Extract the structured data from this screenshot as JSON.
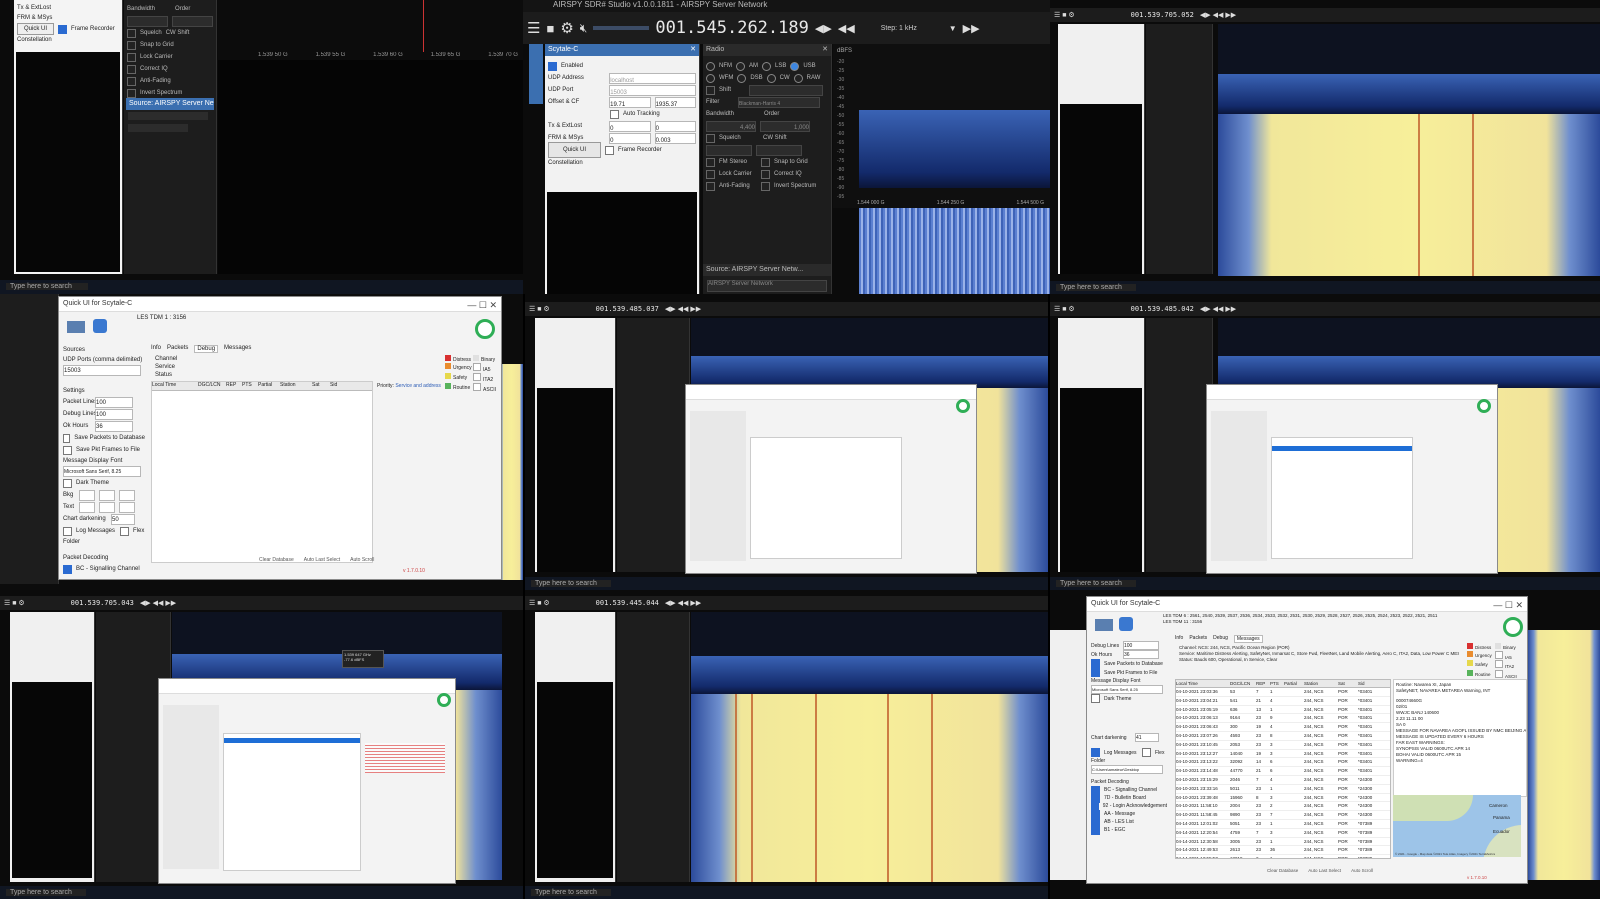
{
  "center": {
    "window_title": "AIRSPY SDR# Studio v1.0.0.1811 - AIRSPY Server Network",
    "frequency": "001.545.262.189",
    "step": "Step: 1 kHz",
    "scytale": {
      "title": "Scytale-C",
      "enabled": "Enabled",
      "udp_address_label": "UDP Address",
      "udp_address": "localhost",
      "udp_port_label": "UDP Port",
      "udp_port": "15003",
      "offset_label": "Offset & CF",
      "offset_a": "19.71",
      "offset_b": "1935.37",
      "auto_tracking": "Auto Tracking",
      "tx_label": "Tx & ExtLost",
      "tx_a": "0",
      "tx_b": "0",
      "frm_label": "FRM & MSys",
      "frm_a": "0",
      "frm_b": "0.003",
      "quick_ui": "Quick UI",
      "frame_recorder": "Frame Recorder",
      "constellation": "Constellation"
    },
    "radio": {
      "title": "Radio",
      "modes": [
        "NFM",
        "AM",
        "LSB",
        "USB",
        "WFM",
        "DSB",
        "CW",
        "RAW"
      ],
      "selected_mode": "USB",
      "shift": "Shift",
      "filter_label": "Filter",
      "filter_value": "Blackman-Harris 4",
      "bandwidth_label": "Bandwidth",
      "bandwidth_value": "4,400",
      "order_label": "Order",
      "order_value": "1,000",
      "squelch": "Squelch",
      "cw_shift": "CW Shift",
      "fm_stereo": "FM Stereo",
      "snap_to_grid": "Snap to Grid",
      "lock_carrier": "Lock Carrier",
      "correct_iq": "Correct IQ",
      "anti_fading": "Anti-Fading",
      "invert_spectrum": "Invert Spectrum"
    },
    "source": {
      "title": "Source: AIRSPY Server Netw...",
      "value": "AIRSPY Server Network"
    },
    "spectrum": {
      "unit": "dBFS",
      "y_ticks": [
        "-20",
        "-25",
        "-30",
        "-35",
        "-40",
        "-45",
        "-50",
        "-55",
        "-60",
        "-65",
        "-70",
        "-75",
        "-80",
        "-85",
        "-90",
        "-95"
      ],
      "x_ticks": [
        "1.544 000 G",
        "1.544 250 G",
        "1.544 500 G"
      ]
    }
  },
  "top_right": {
    "frequency": "001.539.705.052"
  },
  "mid_center": {
    "frequency": "001.539.485.037"
  },
  "mid_right": {
    "frequency": "001.539.485.042"
  },
  "bot_left": {
    "frequency": "001.539.705.043",
    "tooltip": "1.539 647 GHz\n-77.6 dBFS"
  },
  "bot_center": {
    "frequency": "001.539.445.044"
  },
  "left_top": {
    "tx": "Tx & ExtLost",
    "frm": "FRM & MSys",
    "quick_ui": "Quick UI",
    "frame_recorder": "Frame Recorder",
    "constellation": "Constellation",
    "bandwidth": "Bandwidth",
    "order": "Order",
    "squelch": "Squelch",
    "cw_shift": "CW Shift",
    "snap": "Snap to Grid",
    "lock": "Lock Carrier",
    "correct": "Correct IQ",
    "anti": "Anti-Fading",
    "invert": "Invert Spectrum",
    "source": "Source: AIRSPY Server Netw...",
    "x_ticks": [
      "1.539 50 G",
      "1.539 55 G",
      "1.539 60 G",
      "1.539 65 G",
      "1.539 70 G"
    ],
    "search": "Type here to search"
  },
  "qui_main": {
    "title": "Quick UI for Scytale-C",
    "les": "LES TDM 1 : 3156",
    "tabs": [
      "Info",
      "Packets",
      "Debug",
      "Messages"
    ],
    "sources": "Sources",
    "udp_ports": "UDP Ports (comma delimited)",
    "udp_value": "15003",
    "fields": [
      "Channel",
      "Service",
      "Status"
    ],
    "settings": "Settings",
    "packet_lines": "Packet Lines",
    "packet_lines_v": "100",
    "debug_lines": "Debug Lines",
    "debug_lines_v": "100",
    "ok_hours": "Ok Hours",
    "ok_hours_v": "36",
    "save_db": "Save Packets to Database",
    "save_file": "Save Pkt Frames to File",
    "msg_font": "Message Display Font",
    "font_value": "Microsoft Sans Serif, 8.25",
    "dark_theme": "Dark Theme",
    "bkg": "Bkg",
    "text": "Text",
    "chart_darkening": "Chart darkening",
    "chart_darkening_v": "50",
    "log_messages": "Log Messages",
    "flex": "Flex",
    "folder": "Folder",
    "packet_decoding": "Packet Decoding",
    "signalling": "BC - Signalling Channel",
    "columns": [
      "Local Time",
      "DGC/LCN",
      "REP",
      "PTS",
      "Partial",
      "Station",
      "Sat",
      "Sid"
    ],
    "priority": "Priority:",
    "priority_v": "Service and address",
    "legend": [
      "Distress",
      "Urgency",
      "Safety",
      "Routine",
      "Binary",
      "IA5",
      "ITA2",
      "ASCII"
    ],
    "footer": [
      "Clear Database",
      "Auto Last Select",
      "Auto Scroll"
    ],
    "version": "v 1.7.0.10"
  },
  "qui_br": {
    "title": "Quick UI for Scytale-C",
    "les": "LES TDM 6 : 2561, 2540, 2539, 2537, 2536, 2534, 2533, 2532, 2531, 2530, 2529, 2528, 2527, 2526, 2525, 2524, 2523, 2522, 2521, 2511",
    "les2": "LES TDM 11 : 3156",
    "tabs": [
      "Info",
      "Packets",
      "Debug",
      "Messages"
    ],
    "debug_lines": "Debug Lines",
    "debug_lines_v": "100",
    "ok_hours": "Ok Hours",
    "ok_hours_v": "36",
    "save_db": "Save Packets to Database",
    "save_file": "Save Pkt Frames to File",
    "msg_font": "Message Display Font",
    "font_value": "Microsoft Sans Serif, 8.25",
    "dark_theme": "Dark Theme",
    "chart_darkening": "Chart darkening",
    "chart_darkening_v": "41",
    "log_messages": "Log Messages",
    "flex": "Flex",
    "folder": "Folder",
    "folder_v": "C:\\Users\\amateur\\Desktop",
    "packet_decoding": "Packet Decoding",
    "decoders": [
      "BC - Signalling Channel",
      "7D - Bulletin Board",
      "92 - Login Acknowledgement",
      "AA - Message",
      "AB - LES List",
      "B1 - EGC"
    ],
    "channel": "Channel:  NCS: 244, NCS, Pacific Ocean Region (POR)",
    "service": "Service:  Maritime Distress Alerting, SafetyNet, Inmarsat C, Store Fwd, FleetNet, Land Mobile Alerting, Aero C, ITA2, Data, Low Power C MES",
    "status": "Status:  Bauds 600, Operational, In Service, Clear",
    "columns": [
      "Local Time",
      "DGC/LCN",
      "REP",
      "PTS",
      "Partial",
      "Station",
      "Sat",
      "Sid"
    ],
    "rows": [
      [
        "04-10-2021 23:03:36",
        "53",
        "7",
        "1",
        "",
        "244, NCS",
        "POR",
        "*03401"
      ],
      [
        "04-10-2021 23:04:21",
        "541",
        "21",
        "4",
        "",
        "244, NCS",
        "POR",
        "*03401"
      ],
      [
        "04-10-2021 23:05:19",
        "636",
        "13",
        "1",
        "",
        "244, NCS",
        "POR",
        "*03401"
      ],
      [
        "04-10-2021 23:06:13",
        "9164",
        "23",
        "9",
        "",
        "244, NCS",
        "POR",
        "*03401"
      ],
      [
        "04-10-2021 23:06:43",
        "300",
        "19",
        "4",
        "",
        "244, NCS",
        "POR",
        "*03401"
      ],
      [
        "04-10-2021 23:07:26",
        "4593",
        "23",
        "8",
        "",
        "244, NCS",
        "POR",
        "*03401"
      ],
      [
        "04-10-2021 23:10:45",
        "2053",
        "23",
        "3",
        "",
        "244, NCS",
        "POR",
        "*03401"
      ],
      [
        "04-10-2021 23:12:27",
        "14040",
        "19",
        "3",
        "",
        "244, NCS",
        "POR",
        "*03401"
      ],
      [
        "04-10-2021 23:13:22",
        "32092",
        "14",
        "6",
        "",
        "244, NCS",
        "POR",
        "*03401"
      ],
      [
        "04-10-2021 23:14:48",
        "44770",
        "21",
        "6",
        "",
        "244, NCS",
        "POR",
        "*03401"
      ],
      [
        "04-10-2021 23:15:29",
        "2046",
        "7",
        "4",
        "",
        "244, NCS",
        "POR",
        "*24300"
      ],
      [
        "04-10-2021 23:33:16",
        "5011",
        "23",
        "1",
        "",
        "244, NCS",
        "POR",
        "*24300"
      ],
      [
        "04-10-2021 23:39:48",
        "15960",
        "8",
        "3",
        "",
        "244, NCS",
        "POR",
        "*24300"
      ],
      [
        "04-10-2021 11:58:10",
        "2004",
        "23",
        "2",
        "",
        "244, NCS",
        "POR",
        "*24300"
      ],
      [
        "04-10-2021 11:58:45",
        "9890",
        "23",
        "7",
        "",
        "244, NCS",
        "POR",
        "*24300"
      ],
      [
        "04-14-2021 12:01:02",
        "5051",
        "23",
        "1",
        "",
        "244, NCS",
        "POR",
        "*07389"
      ],
      [
        "04-14-2021 12:20:54",
        "4759",
        "7",
        "3",
        "",
        "244, NCS",
        "POR",
        "*07389"
      ],
      [
        "04-14-2021 12:30:58",
        "3005",
        "23",
        "1",
        "",
        "244, NCS",
        "POR",
        "*07389"
      ],
      [
        "04-14-2021 12:49:53",
        "2613",
        "23",
        "36",
        "",
        "244, NCS",
        "POR",
        "*07389"
      ],
      [
        "04-14-2021 12:55:57",
        "18019",
        "2",
        "1",
        "",
        "244, NCS",
        "POR",
        "*07389"
      ],
      [
        "04-14-2021 12:56:54",
        "7013",
        "1",
        "2",
        "",
        "244, NCS",
        "POR",
        "*07389"
      ]
    ],
    "routine": "Routine: Navarea XI, Japan",
    "routine2": "SafetyNET, NAVAREA METAREA Warning, INT",
    "message": [
      "000074660G",
      "02/01",
      "WWJC BANJ 140600",
      "2.23 11.11 00",
      "SA 0",
      "MESSAGE FOR NAVAREA AGOFL ISSUED BY NMC BEIJING AT 1830UTC APR 14 2021",
      "MESSAGE IS UPDATED EVERY 6 HOURS",
      "FAR EAST WARNINGS:",
      "SYNOPSIS VALID 0600UTC APR 14",
      "BOHAI VALID 0600UTC APR 15",
      "WARNING=4"
    ],
    "legend": [
      "Distress",
      "Urgency",
      "Safety",
      "Routine",
      "Binary",
      "IA5",
      "ITA2",
      "ASCII"
    ],
    "map_labels": [
      "Cameron",
      "Panama",
      "Ecuador"
    ],
    "footer": [
      "Clear Database",
      "Auto Last Select",
      "Auto Scroll"
    ],
    "map_credit": "© 2021 - Google - Map data ©2021 Tele Atlas, Imagery ©2021 TerraMetrics",
    "version": "v 1.7.0.10"
  },
  "taskbar": {
    "search": "Type here to search"
  }
}
